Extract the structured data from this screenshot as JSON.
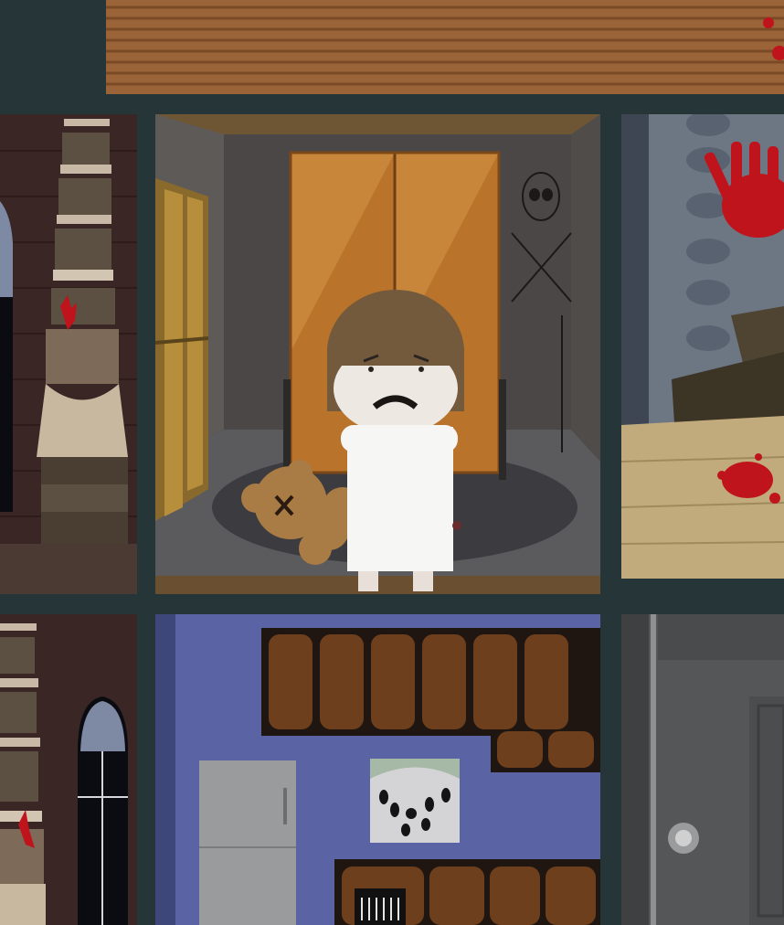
{
  "game": {
    "rooms": [
      {
        "id": "attic-top",
        "label": ""
      },
      {
        "id": "staircase-left",
        "label": ""
      },
      {
        "id": "bedroom-center",
        "label": ""
      },
      {
        "id": "bloody-room-right",
        "label": ""
      },
      {
        "id": "staircase-lower-left",
        "label": ""
      },
      {
        "id": "kitchen-lower-center",
        "label": ""
      },
      {
        "id": "grey-room-lower-right",
        "label": ""
      }
    ],
    "character": {
      "name": "",
      "mood": "sad"
    },
    "items": [
      "teddy-bear",
      "wardrobe",
      "skull-poster",
      "bloody-handprint"
    ],
    "colors": {
      "frame": "#263538",
      "wardrobe": "#b9732a",
      "kitchen_wall": "#5a63a3",
      "blood": "#c0141c"
    }
  }
}
